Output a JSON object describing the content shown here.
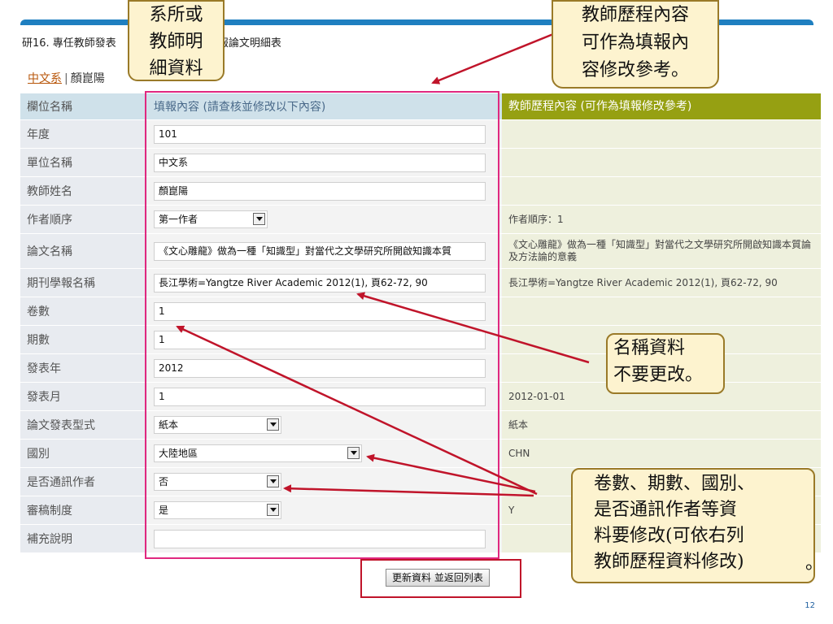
{
  "header": {
    "title_prefix": "研16. 專任教師發表",
    "title_suffix": "學報論文明細表"
  },
  "breadcrumb": {
    "dept_link": "中文系",
    "separator": "|",
    "teacher": "顏崑陽"
  },
  "table": {
    "headers": {
      "field": "欄位名稱",
      "fill": "填報內容 (請查核並修改以下內容)",
      "ref": "教師歷程內容 (可作為填報修改參考)"
    },
    "rows": [
      {
        "label": "年度",
        "value": "101",
        "ref": ""
      },
      {
        "label": "單位名稱",
        "value": "中文系",
        "ref": ""
      },
      {
        "label": "教師姓名",
        "value": "顏崑陽",
        "ref": ""
      },
      {
        "label": "作者順序",
        "value": "第一作者",
        "ref": "作者順序：1"
      },
      {
        "label": "論文名稱",
        "value": "《文心雕龍》做為一種「知識型」對當代之文學研究所開啟知識本質",
        "ref": "《文心雕龍》做為一種「知識型」對當代之文學研究所開啟知識本質論及方法論的意義"
      },
      {
        "label": "期刊學報名稱",
        "value": "長江學術=Yangtze River Academic 2012(1), 頁62-72, 90",
        "ref": "長江學術=Yangtze River Academic 2012(1), 頁62-72, 90"
      },
      {
        "label": "卷數",
        "value": "1",
        "ref": ""
      },
      {
        "label": "期數",
        "value": "1",
        "ref": ""
      },
      {
        "label": "發表年",
        "value": "2012",
        "ref": ""
      },
      {
        "label": "發表月",
        "value": "1",
        "ref": "2012-01-01"
      },
      {
        "label": "論文發表型式",
        "value": "紙本",
        "ref": "紙本"
      },
      {
        "label": "國別",
        "value": "大陸地區",
        "ref": "CHN"
      },
      {
        "label": "是否通訊作者",
        "value": "否",
        "ref": ""
      },
      {
        "label": "審稿制度",
        "value": "是",
        "ref": "Y"
      },
      {
        "label": "補充說明",
        "value": "",
        "ref": ""
      }
    ]
  },
  "button": {
    "label": "更新資料 並返回列表"
  },
  "callouts": {
    "dept": [
      "系所或",
      "教師明",
      "細資料"
    ],
    "history": [
      "教師歷程內容",
      "可作為填報內",
      "容修改參考。"
    ],
    "name": [
      "名稱資料",
      "不要更改。"
    ],
    "fields": [
      "卷數、期數、國別、",
      "是否通訊作者等資",
      "料要修改(可依右列",
      "教師歷程資料修改)"
    ],
    "fields_tail": "。"
  },
  "page_number": "12",
  "colors": {
    "header_blue": "#cfe1ea",
    "header_olive": "#96a012",
    "ref_bg": "#eef0dd",
    "highlight_pink": "#e0287f",
    "highlight_red": "#c0142a",
    "arrow_red": "#c0142a",
    "callout_bg": "#fdf3cf",
    "top_bar": "#1f7fc0"
  }
}
